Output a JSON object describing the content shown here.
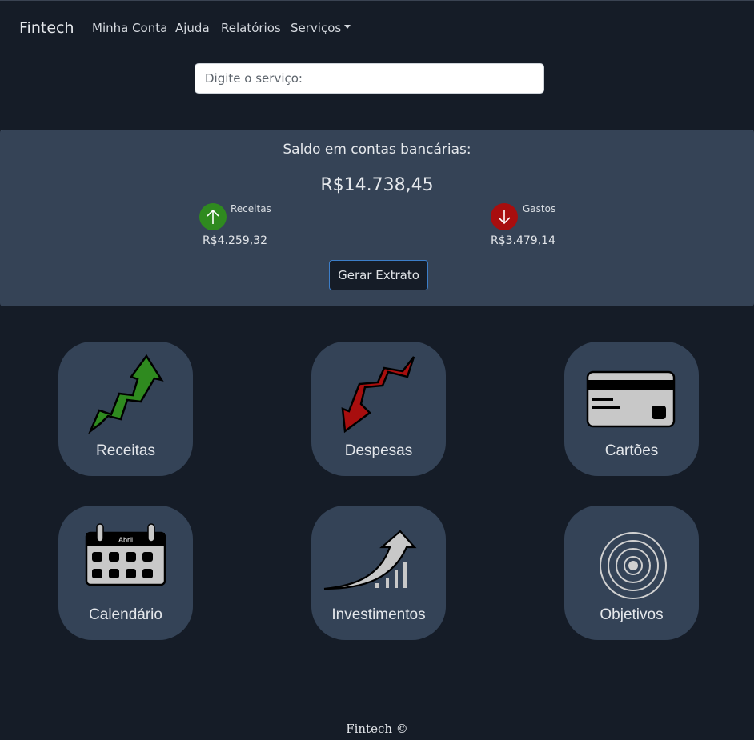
{
  "navbar": {
    "brand": "Fintech",
    "items": [
      {
        "label": "Minha Conta"
      },
      {
        "label": "Ajuda"
      },
      {
        "label": "Relatórios"
      },
      {
        "label": "Serviços"
      }
    ]
  },
  "search": {
    "placeholder": "Digite o serviço:",
    "value": ""
  },
  "balance": {
    "title": "Saldo em contas bancárias:",
    "total": "R$14.738,45",
    "income": {
      "label": "Receitas",
      "value": "R$4.259,32",
      "color": "#2f8a1f",
      "icon": "arrow-up-icon"
    },
    "expenses": {
      "label": "Gastos",
      "value": "R$3.479,14",
      "color": "#a80e0e",
      "icon": "arrow-down-icon"
    },
    "button_label": "Gerar Extrato"
  },
  "tiles": [
    {
      "label": "Receitas",
      "icon": "rising-arrow-icon"
    },
    {
      "label": "Despesas",
      "icon": "falling-arrow-icon"
    },
    {
      "label": "Cartões",
      "icon": "credit-card-icon"
    },
    {
      "label": "Calendário",
      "icon": "calendar-icon",
      "calendar_month": "Abril"
    },
    {
      "label": "Investimentos",
      "icon": "investment-growth-icon"
    },
    {
      "label": "Objetivos",
      "icon": "target-icon"
    }
  ],
  "footer": {
    "text": "Fintech ©"
  },
  "colors": {
    "page_background": "#151c27",
    "panel_background": "#354356",
    "tile_background": "#344357",
    "button_border": "#3c7ec9"
  }
}
